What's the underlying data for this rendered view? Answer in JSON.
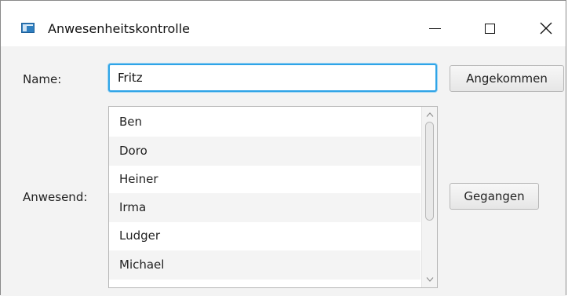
{
  "window": {
    "title": "Anwesenheitskontrolle",
    "icon": "app-window-icon"
  },
  "form": {
    "name_label": "Name:",
    "name_value": "Fritz",
    "arrived_button": "Angekommen",
    "present_label": "Anwesend:",
    "left_button": "Gegangen"
  },
  "list": {
    "items": [
      "Ben",
      "Doro",
      "Heiner",
      "Irma",
      "Ludger",
      "Michael"
    ]
  },
  "colors": {
    "focus": "#2fa4e7",
    "background": "#f3f3f3"
  }
}
